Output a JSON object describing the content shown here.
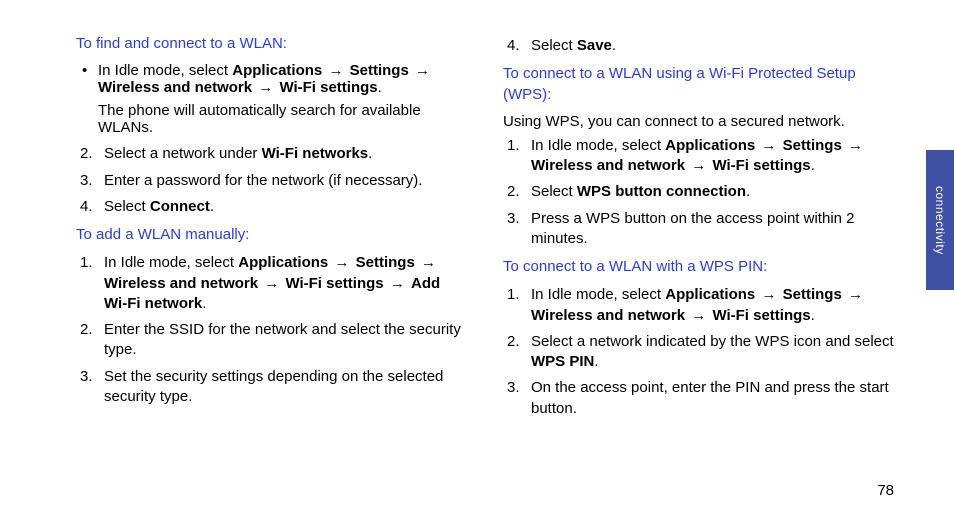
{
  "arrow": "→",
  "sideTab": "connectivity",
  "pageNumber": "78",
  "col1": {
    "h1": "To find and connect to a WLAN:",
    "bullet1_pre": "In Idle mode, select ",
    "b_app": "Applications",
    "b_set": "Settings",
    "b_wn": "Wireless and network",
    "b_ws": "Wi-Fi settings",
    "bullet1_sub": "The phone will automatically search for available WLANs.",
    "n2_pre": "Select a network under ",
    "n2_bold": "Wi-Fi networks",
    "n3": "Enter a password for the network (if necessary).",
    "n4_pre": "Select ",
    "n4_bold": "Connect",
    "h2": "To add a WLAN manually:",
    "m1_pre": "In Idle mode, select ",
    "m1_add": "Add Wi-Fi network",
    "m2": "Enter the SSID for the network and select the security type.",
    "m3": "Set the security settings depending on the selected security type."
  },
  "col2": {
    "n4_pre": "Select ",
    "n4_bold": "Save",
    "h1": "To connect to a WLAN using a Wi-Fi Protected Setup (WPS):",
    "intro": "Using WPS, you can connect to a secured network.",
    "w1_pre": "In Idle mode, select ",
    "w2_pre": "Select ",
    "w2_bold": "WPS button connection",
    "w3": "Press a WPS button on the access point within 2 minutes.",
    "h2": "To connect to a WLAN with a WPS PIN:",
    "p1_pre": "In Idle mode, select ",
    "p2_pre": "Select a network indicated by the WPS icon and select ",
    "p2_bold": "WPS PIN",
    "p3": "On the access point, enter the PIN and press the start button."
  }
}
